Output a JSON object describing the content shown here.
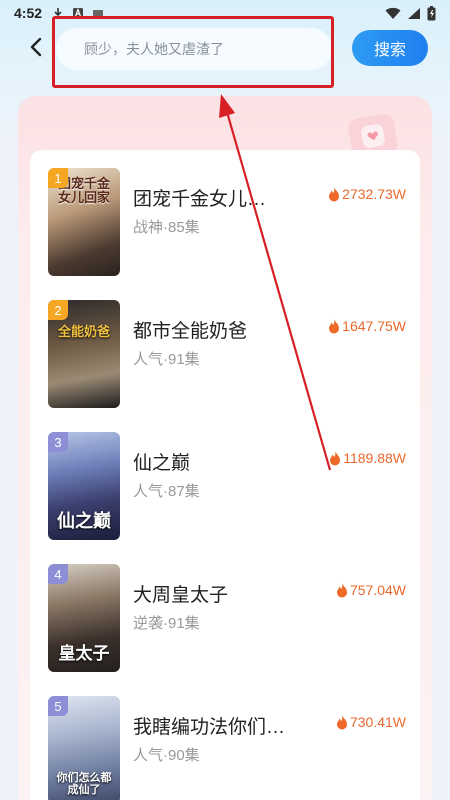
{
  "status_bar": {
    "time": "4:52"
  },
  "search": {
    "placeholder": "顾少，夫人她又虐渣了",
    "button_label": "搜索"
  },
  "ranking": {
    "items": [
      {
        "rank": "1",
        "title": "团宠千金女儿…",
        "meta": "战神·85集",
        "heat": "2732.73W",
        "badge_color": "#f5a623",
        "cover_text": "团宠千金女儿回家"
      },
      {
        "rank": "2",
        "title": "都市全能奶爸",
        "meta": "人气·91集",
        "heat": "1647.75W",
        "badge_color": "#f5a623",
        "cover_text": "全能奶爸"
      },
      {
        "rank": "3",
        "title": "仙之巅",
        "meta": "人气·87集",
        "heat": "1189.88W",
        "badge_color": "#8c8fd6",
        "cover_text": "仙之巅"
      },
      {
        "rank": "4",
        "title": "大周皇太子",
        "meta": "逆袭·91集",
        "heat": "757.04W",
        "badge_color": "#8c8fd6",
        "cover_text": "皇太子"
      },
      {
        "rank": "5",
        "title": "我瞎编功法你们…",
        "meta": "人气·90集",
        "heat": "730.41W",
        "badge_color": "#8c8fd6",
        "cover_text": "你们怎么都成仙了"
      }
    ]
  },
  "colors": {
    "accent": "#1f7ef0",
    "heat": "#e9682c",
    "annotation_red": "#d81f26"
  }
}
